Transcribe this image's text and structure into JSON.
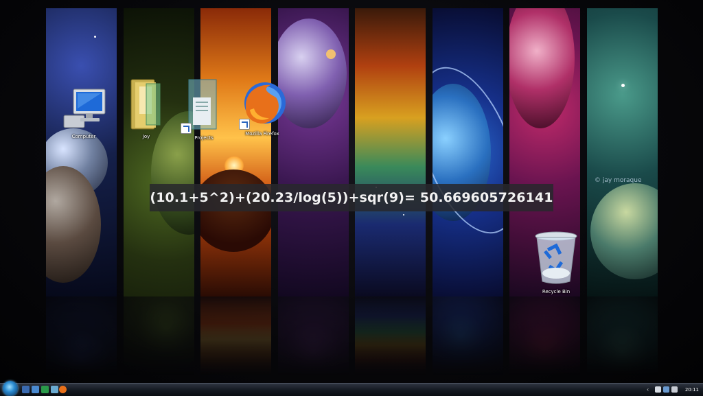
{
  "desktop": {
    "icons": [
      {
        "label": "Computer"
      },
      {
        "label": "Joy"
      },
      {
        "label": "Projects"
      },
      {
        "label": "Mozilla Firefox"
      },
      {
        "label": "Recycle Bin"
      }
    ],
    "watermark": "© jay moraque"
  },
  "calculator_overlay": {
    "expression": "(10.1+5^2)+(20.23/log(5))+sqr(9)= 50.669605726141"
  },
  "taskbar": {
    "clock": "20:11",
    "quick_launch": [
      "show-desktop-icon",
      "switch-windows-icon",
      "media-player-icon",
      "firefox-icon",
      "folder-icon"
    ]
  }
}
